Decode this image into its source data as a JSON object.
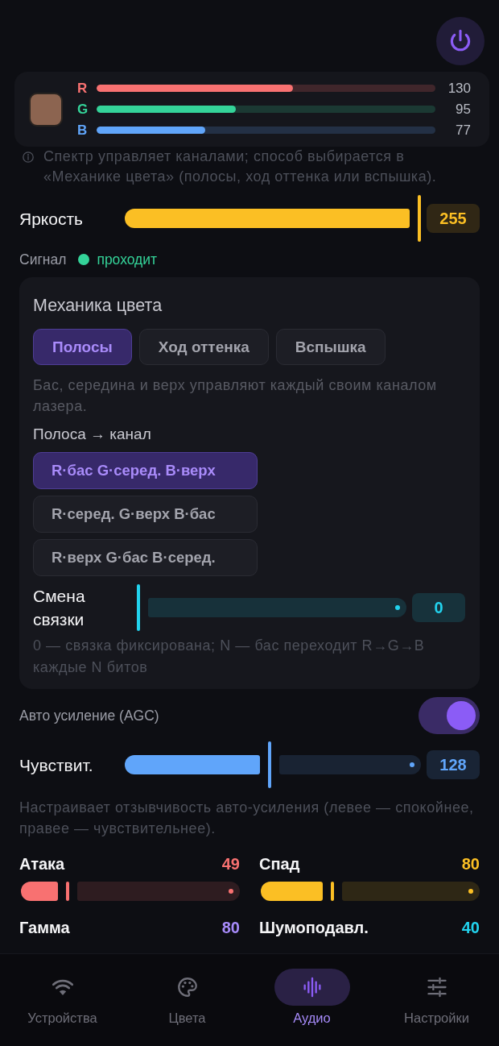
{
  "color_preview": {
    "color": "#8c6450",
    "channels": [
      {
        "label": "R",
        "value": "130",
        "level": 0.58,
        "color": "#f87171"
      },
      {
        "label": "G",
        "value": "95",
        "level": 0.41,
        "color": "#34d399"
      },
      {
        "label": "B",
        "value": "77",
        "level": 0.32,
        "color": "#60a5fa"
      }
    ]
  },
  "info_note": "Спектр управляет каналами; способ выбирается в «Механике цвета» (полосы, ход оттенка или вспышка).",
  "brightness": {
    "label": "Яркость",
    "value": "255",
    "level": 1,
    "color": "#fbbf24"
  },
  "signal": {
    "label": "Сигнал",
    "status": "проходит",
    "color": "#34d399"
  },
  "color_mechanics": {
    "title": "Механика цвета",
    "modes": [
      {
        "label": "Полосы",
        "selected": true
      },
      {
        "label": "Ход оттенка",
        "selected": false
      },
      {
        "label": "Вспышка",
        "selected": false
      }
    ],
    "description": "Бас, середина и верх управляют каждый своим каналом лазера.",
    "mapping_label": "Полоса → канал",
    "mappings": [
      {
        "label": "R·бас G·серед. B·верх",
        "selected": true
      },
      {
        "label": "R·серед. G·верх B·бас",
        "selected": false
      },
      {
        "label": "R·верх G·бас B·серед.",
        "selected": false
      }
    ],
    "rotation": {
      "label": "Смена связки",
      "value": "0",
      "level": 0,
      "color": "#22d3ee"
    },
    "rotation_note": "0 — связка фиксирована; N — бас переходит R→G→B каждые N битов"
  },
  "agc": {
    "label": "Авто усиление (AGC)",
    "on": true
  },
  "sensitivity": {
    "label": "Чувствит.",
    "value": "128",
    "level": 0.5,
    "color": "#60a5fa"
  },
  "sensitivity_note": "Настраивает отзывчивость авто-усиления (левее — спокойнее, правее — чувствительнее).",
  "parameters": [
    {
      "label": "Атака",
      "value": "49",
      "color": "#f87171",
      "level": 0.19
    },
    {
      "label": "Спад",
      "value": "80",
      "color": "#fbbf24",
      "level": 0.32
    },
    {
      "label": "Гамма",
      "value": "80",
      "color": "#a78bfa"
    },
    {
      "label": "Шумоподавл.",
      "value": "40",
      "color": "#22d3ee"
    }
  ],
  "nav": [
    {
      "label": "Устройства",
      "kind": "wifi",
      "selected": false
    },
    {
      "label": "Цвета",
      "kind": "palette",
      "selected": false
    },
    {
      "label": "Аудио",
      "kind": "waveform",
      "selected": true
    },
    {
      "label": "Настройки",
      "kind": "sliders",
      "selected": false
    }
  ]
}
